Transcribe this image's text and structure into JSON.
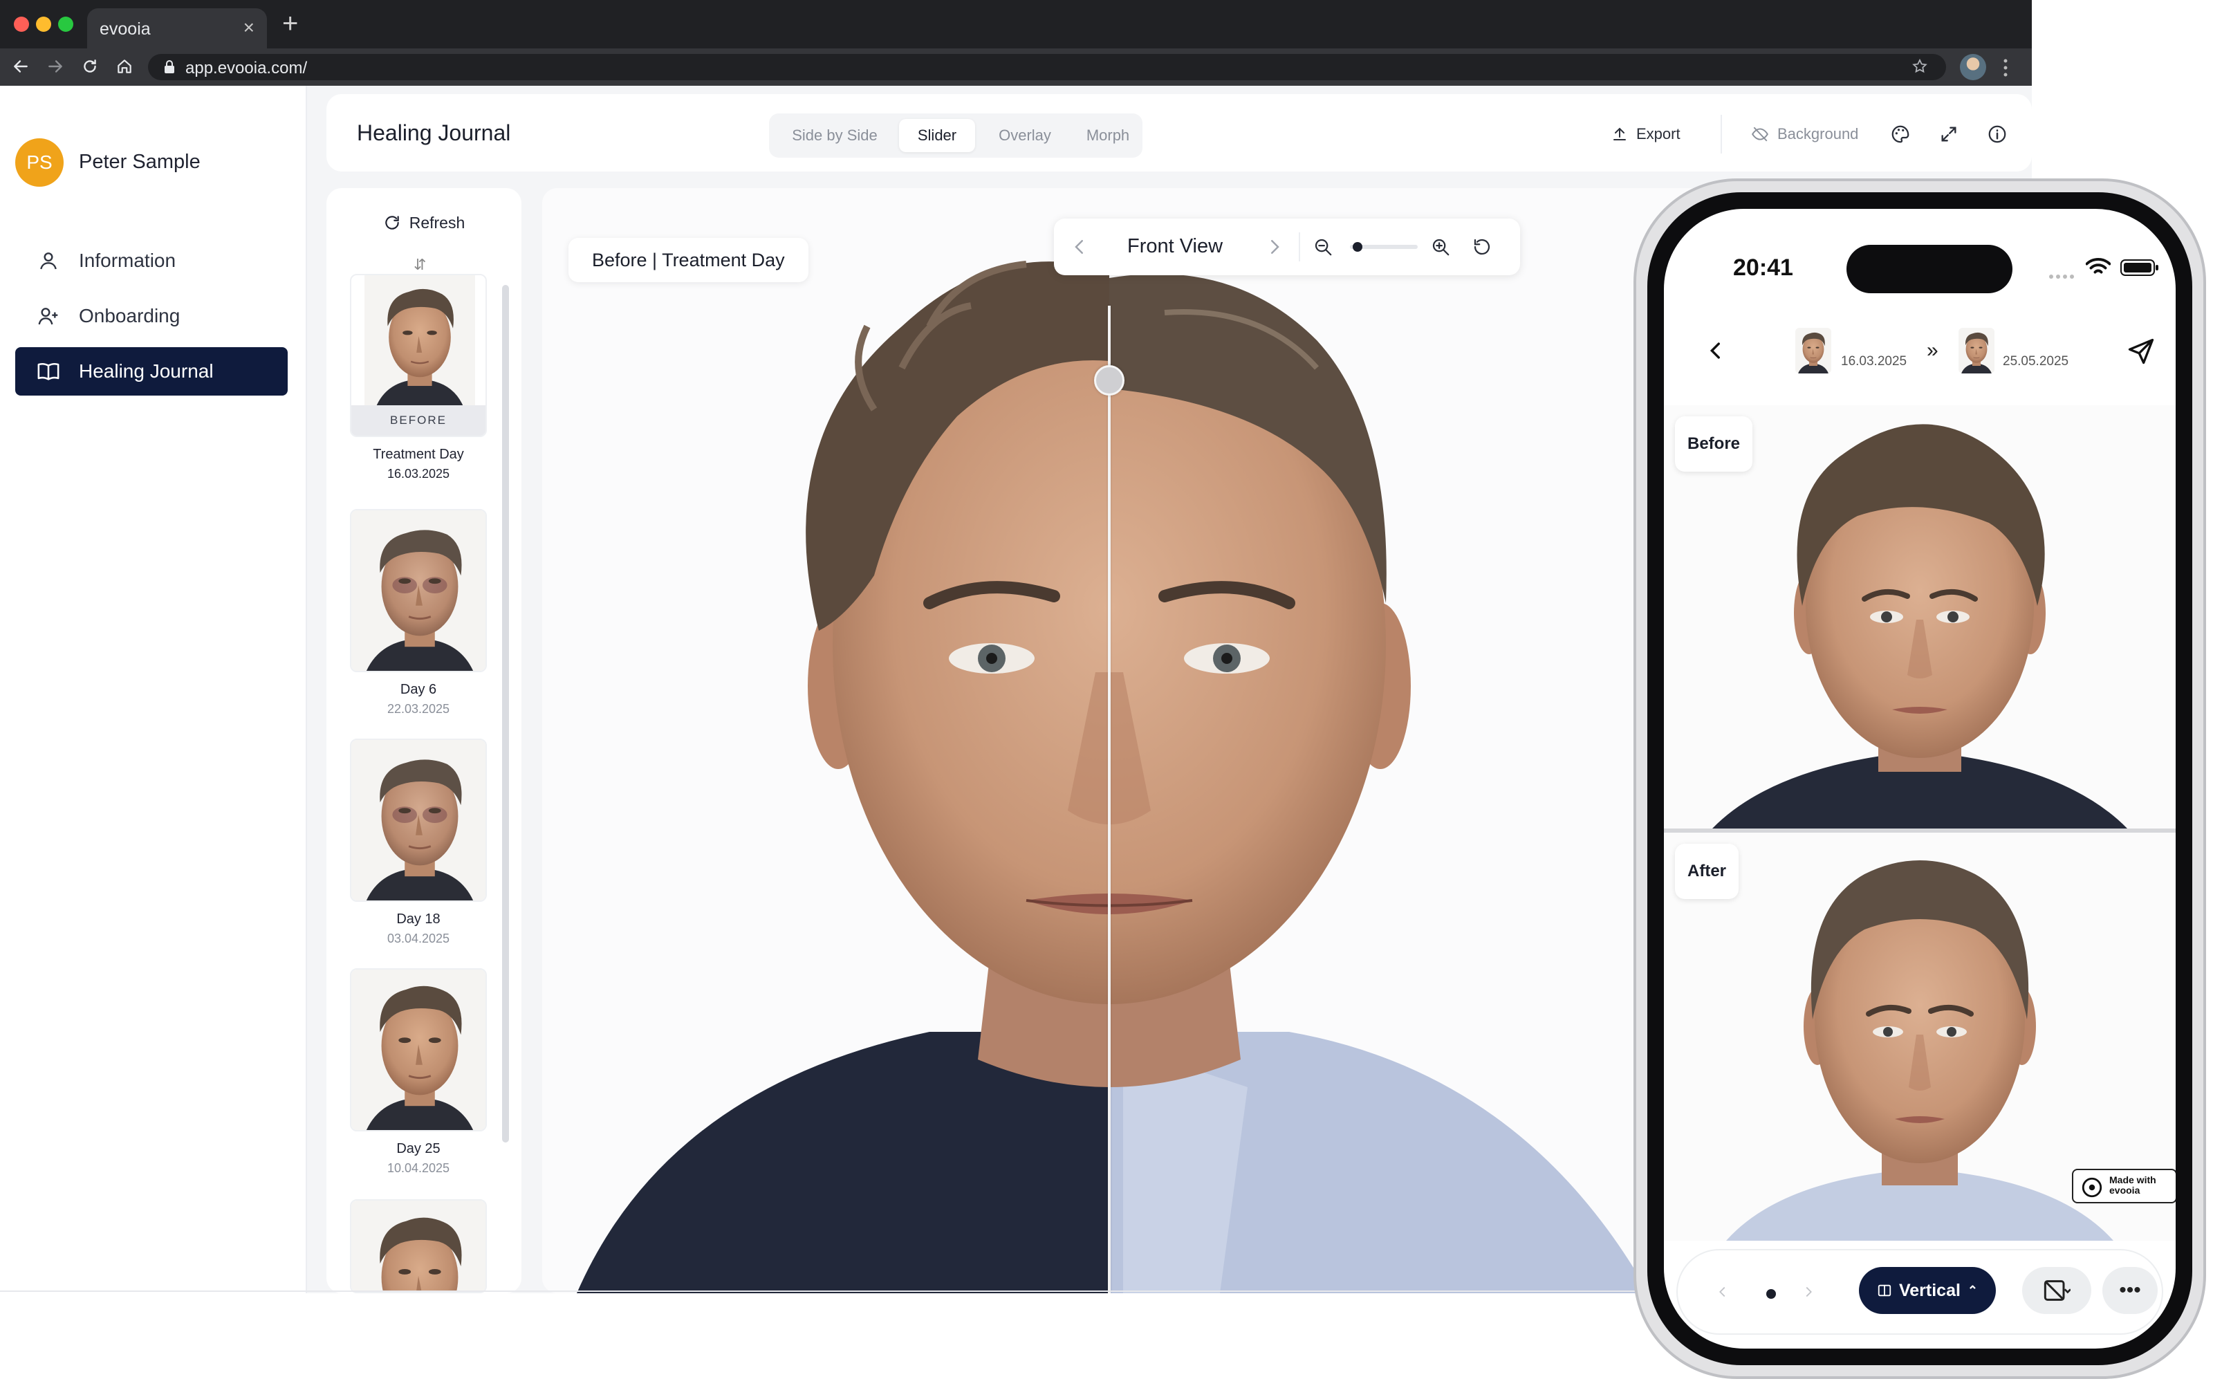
{
  "browser": {
    "tab_title": "evooia",
    "tab_close": "×",
    "new_tab": "+",
    "url": "app.evooia.com/"
  },
  "user": {
    "initials": "PS",
    "name": "Peter Sample"
  },
  "sidebar": {
    "items": [
      {
        "label": "Information",
        "icon": "user-icon"
      },
      {
        "label": "Onboarding",
        "icon": "user-plus-icon"
      },
      {
        "label": "Healing Journal",
        "icon": "book-icon",
        "active": true
      }
    ]
  },
  "header": {
    "title": "Healing Journal",
    "view_modes": [
      "Side by Side",
      "Slider",
      "Overlay",
      "Morph"
    ],
    "active_mode": "Slider",
    "export_label": "Export",
    "background_label": "Background"
  },
  "timeline": {
    "refresh_label": "Refresh",
    "items": [
      {
        "badge": "BEFORE",
        "label": "Treatment Day",
        "date": "16.03.2025"
      },
      {
        "label": "Day 6",
        "date": "22.03.2025"
      },
      {
        "label": "Day 18",
        "date": "03.04.2025"
      },
      {
        "label": "Day 25",
        "date": "10.04.2025"
      }
    ]
  },
  "viewer": {
    "tag": "Before | Treatment Day",
    "view_title": "Front View",
    "zoom_level": 0.05
  },
  "phone": {
    "time": "20:41",
    "date_from": "16.03.2025",
    "date_to": "25.05.2025",
    "compare_separator": "»",
    "before_label": "Before",
    "after_label": "After",
    "watermark": "Made with evooia",
    "layout_button": "Vertical",
    "layout_caret": "⌃",
    "more": "•••"
  },
  "colors": {
    "accent_navy": "#0f1b3d",
    "avatar_orange": "#f0a31a"
  }
}
